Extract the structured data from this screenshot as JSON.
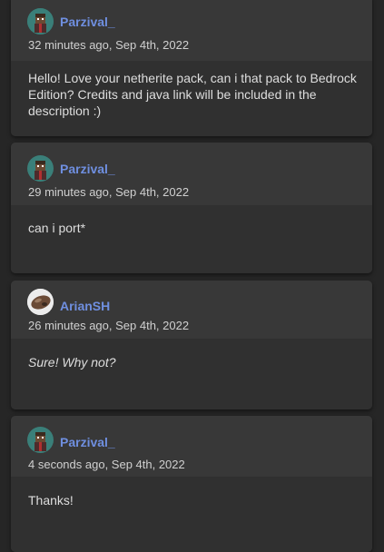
{
  "comments": [
    {
      "username": "Parzival_",
      "avatar": "steve-skin-avatar",
      "timestamp": "32 minutes ago, Sep 4th, 2022",
      "message": "Hello! Love your netherite pack, can i that pack to Bedrock Edition? Credits and java link will be included in the description :)"
    },
    {
      "username": "Parzival_",
      "avatar": "steve-skin-avatar",
      "timestamp": "29 minutes ago, Sep 4th, 2022",
      "message": "can i port*"
    },
    {
      "username": "ArianSH",
      "avatar": "ore-avatar",
      "timestamp": "26 minutes ago, Sep 4th, 2022",
      "message": "Sure! Why not?"
    },
    {
      "username": "Parzival_",
      "avatar": "steve-skin-avatar",
      "timestamp": "4 seconds ago, Sep 4th, 2022",
      "message": "Thanks!"
    }
  ],
  "colors": {
    "username": "#6f8fe0",
    "page_bg": "#262626",
    "card_bg": "#333333"
  }
}
